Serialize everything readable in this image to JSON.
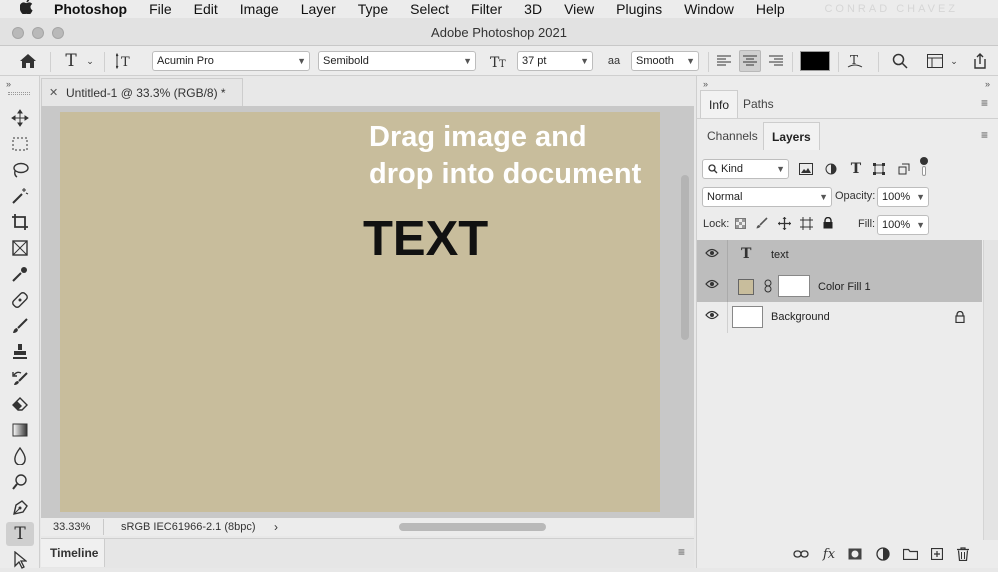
{
  "menubar": {
    "apple": "",
    "items": [
      "Photoshop",
      "File",
      "Edit",
      "Image",
      "Layer",
      "Type",
      "Select",
      "Filter",
      "3D",
      "View",
      "Plugins",
      "Window",
      "Help"
    ],
    "watermark": "CONRAD CHAVEZ"
  },
  "window": {
    "title": "Adobe Photoshop 2021"
  },
  "options": {
    "font_family": "Acumin Pro",
    "font_style": "Semibold",
    "font_size": "37 pt",
    "antialias_icon": "aa",
    "antialias": "Smooth",
    "text_color": "#000000"
  },
  "document": {
    "tab_title": "Untitled-1 @ 33.3% (RGB/8) *",
    "overlay_line1": "Drag image and",
    "overlay_line2": "drop into document",
    "canvas_text": "TEXT",
    "canvas_color": "#c8bd9c",
    "zoom": "33.33%",
    "color_profile": "sRGB IEC61966-2.1 (8bpc)"
  },
  "timeline": {
    "label": "Timeline"
  },
  "panels": {
    "tabs_top": [
      "Info",
      "Paths"
    ],
    "tabs_layers": [
      "Channels",
      "Layers"
    ],
    "filter_kind": "Kind",
    "blend_mode": "Normal",
    "opacity_label": "Opacity:",
    "opacity": "100%",
    "lock_label": "Lock:",
    "fill_label": "Fill:",
    "fill": "100%",
    "layers": [
      {
        "name": "text",
        "type": "text"
      },
      {
        "name": "Color Fill 1",
        "type": "fill"
      },
      {
        "name": "Background",
        "type": "background"
      }
    ]
  }
}
